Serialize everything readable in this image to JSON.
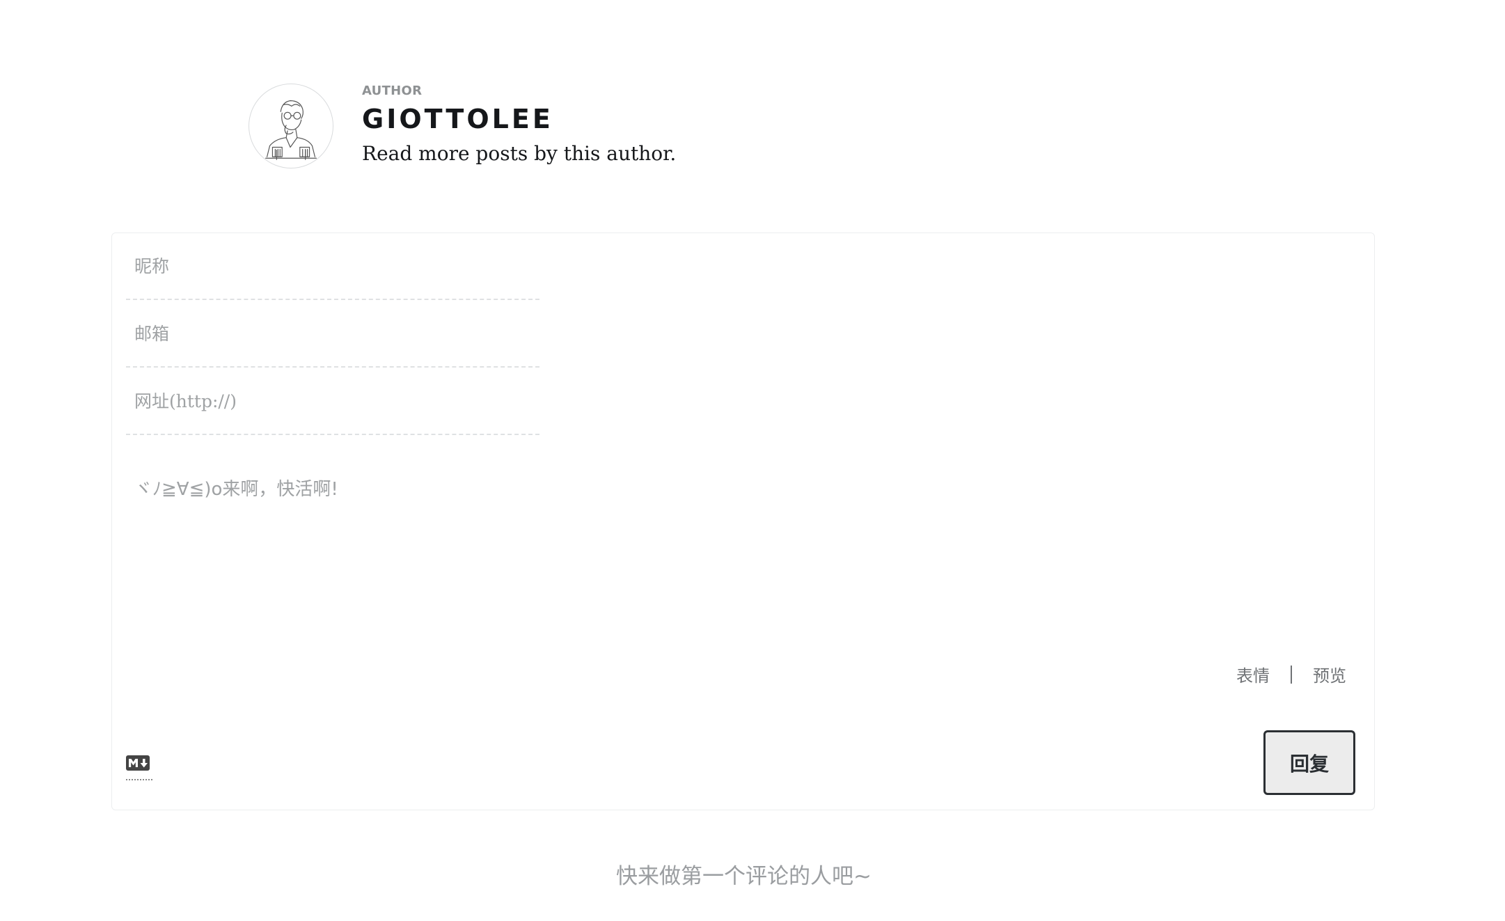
{
  "author": {
    "eyebrow": "AUTHOR",
    "name": "GIOTTOLEE",
    "link_text": "Read more posts by this author."
  },
  "comment_form": {
    "nick_placeholder": "昵称",
    "mail_placeholder": "邮箱",
    "link_placeholder": "网址(http://)",
    "content_placeholder": "ヾﾉ≧∀≦)o来啊，快活啊!",
    "emoji_label": "表情",
    "preview_label": "预览",
    "submit_label": "回复",
    "markdown_icon": "markdown-icon"
  },
  "empty_hint": "快来做第一个评论的人吧~",
  "colors": {
    "text_primary": "#15171a",
    "text_muted": "#9fa2a4",
    "button_border": "#2b2f33",
    "button_bg": "#ececec"
  }
}
